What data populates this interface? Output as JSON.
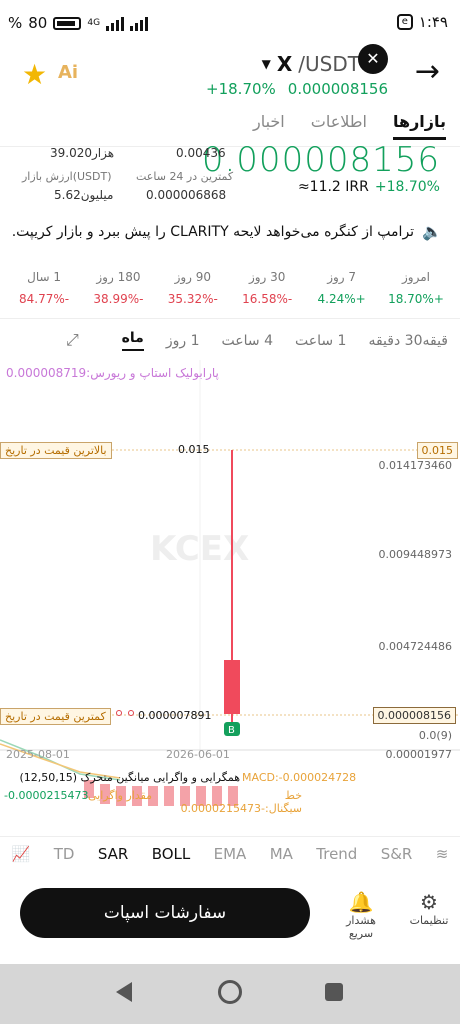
{
  "status": {
    "battery": "80",
    "network": "4G",
    "time": "۱:۴۹"
  },
  "header": {
    "favorite_icon": "star-icon",
    "ai_label": "Ai",
    "base": "X",
    "quote": "/USDT",
    "change": "+18.70%",
    "price": "0.000008156",
    "back_icon": "arrow-right-icon"
  },
  "tabs": [
    "بازارها",
    "اطلاعات",
    "اخبار"
  ],
  "stats": {
    "big_price": "0.000008156",
    "low24_label": "کمترین در 24 ساعت",
    "low24_value": "0.000006868",
    "vol_value": "0.00436",
    "mcap_label": "ارزش بازار(USDT)",
    "mcap_value": "5.62میلیون",
    "cap2_value": "39.020هزار",
    "irr_value": "≈11.2 IRR",
    "irr_change": "+18.70%"
  },
  "news": "ترامپ از کنگره می‌خواهد لایحه CLARITY را پیش ببرد و بازار کریپت.",
  "performance": [
    {
      "label": "امروز",
      "value": "+18.70%",
      "color": "#12a05c"
    },
    {
      "label": "7 روز",
      "value": "+4.24%",
      "color": "#12a05c"
    },
    {
      "label": "30 روز",
      "value": "-16.58%",
      "color": "#e0424f"
    },
    {
      "label": "90 روز",
      "value": "-35.32%",
      "color": "#e0424f"
    },
    {
      "label": "180 روز",
      "value": "-38.99%",
      "color": "#e0424f"
    },
    {
      "label": "1 سال",
      "value": "-84.77%",
      "color": "#e0424f"
    }
  ],
  "intervals": [
    "قیقه30 دقیقه",
    "1 ساعت",
    "4 ساعت",
    "1 روز",
    "ماه"
  ],
  "chart": {
    "sar_label": "پارابولیک استاپ و ریورس:0.000008719",
    "ath_label": "بالاترین قیمت در تاریخ",
    "ath_value": "0.015",
    "atl_label": "کمترین قیمت در تاریخ",
    "atl_value": "0.000007891",
    "current_price_tag": "0.000008156",
    "right_tag": "0.015",
    "y_labels": [
      "0.014173460",
      "0.009448973",
      "0.004724486",
      "0.0(9)"
    ],
    "x_labels": [
      "2025-08-01",
      "2026-06-01"
    ],
    "macd_scale": "0.00001977",
    "macd_title": "همگرایی و واگرایی میانگین متحرک (12,50,15)",
    "macd_value": "MACD:-0.000024728",
    "signal_label": "خط سیگنال:-0.0000215473",
    "signal_value": "-0.0000215473",
    "hist_label": "مقدار واگرایی",
    "buy_marker": "B",
    "watermark": "KCEX"
  },
  "indicators": [
    "TD",
    "SAR",
    "BOLL",
    "EMA",
    "MA",
    "Trend",
    "S&R"
  ],
  "actions": {
    "spot_order": "سفارشات اسپات",
    "alert": "هشدار سریع",
    "settings": "تنظیمات"
  }
}
